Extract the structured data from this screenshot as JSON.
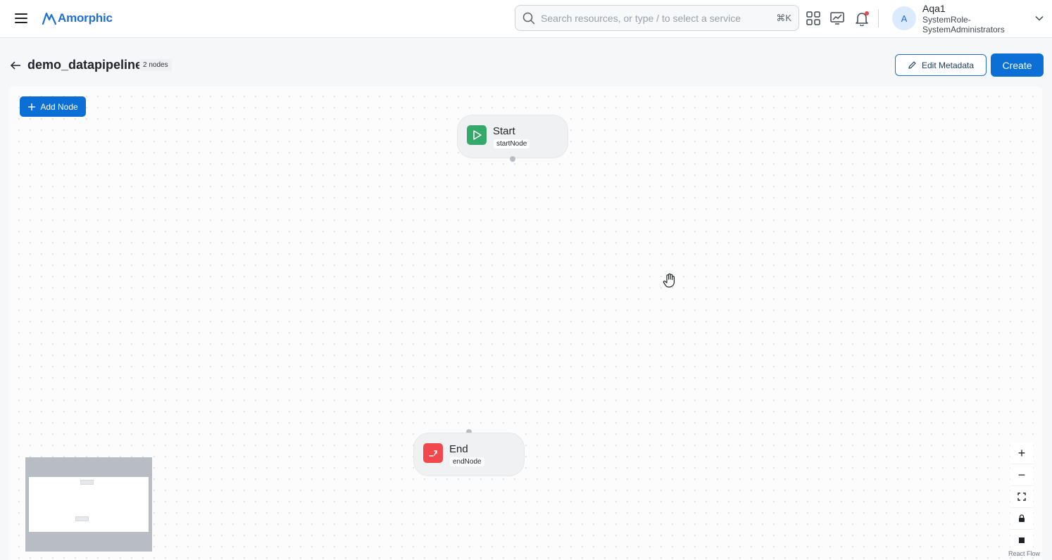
{
  "app": {
    "name": "Amorphic"
  },
  "search": {
    "placeholder": "Search resources, or type / to select a service",
    "shortcut": "⌘K"
  },
  "user": {
    "initial": "A",
    "name": "Aqa1",
    "role": "SystemRole-SystemAdministrators"
  },
  "page": {
    "title": "demo_datapipeline",
    "node_count": "2 nodes"
  },
  "actions": {
    "edit_metadata": "Edit Metadata",
    "create": "Create",
    "add_node": "Add Node"
  },
  "nodes": [
    {
      "title": "Start",
      "type": "startNode",
      "icon": "play-icon",
      "color": "#36a86b"
    },
    {
      "title": "End",
      "type": "endNode",
      "icon": "end-icon",
      "color": "#f0484d"
    }
  ],
  "controls": {
    "zoom_in": "+",
    "zoom_out": "−"
  },
  "footer": {
    "attribution": "React Flow"
  },
  "colors": {
    "primary": "#0b6fd6",
    "start": "#36a86b",
    "end": "#f0484d"
  }
}
